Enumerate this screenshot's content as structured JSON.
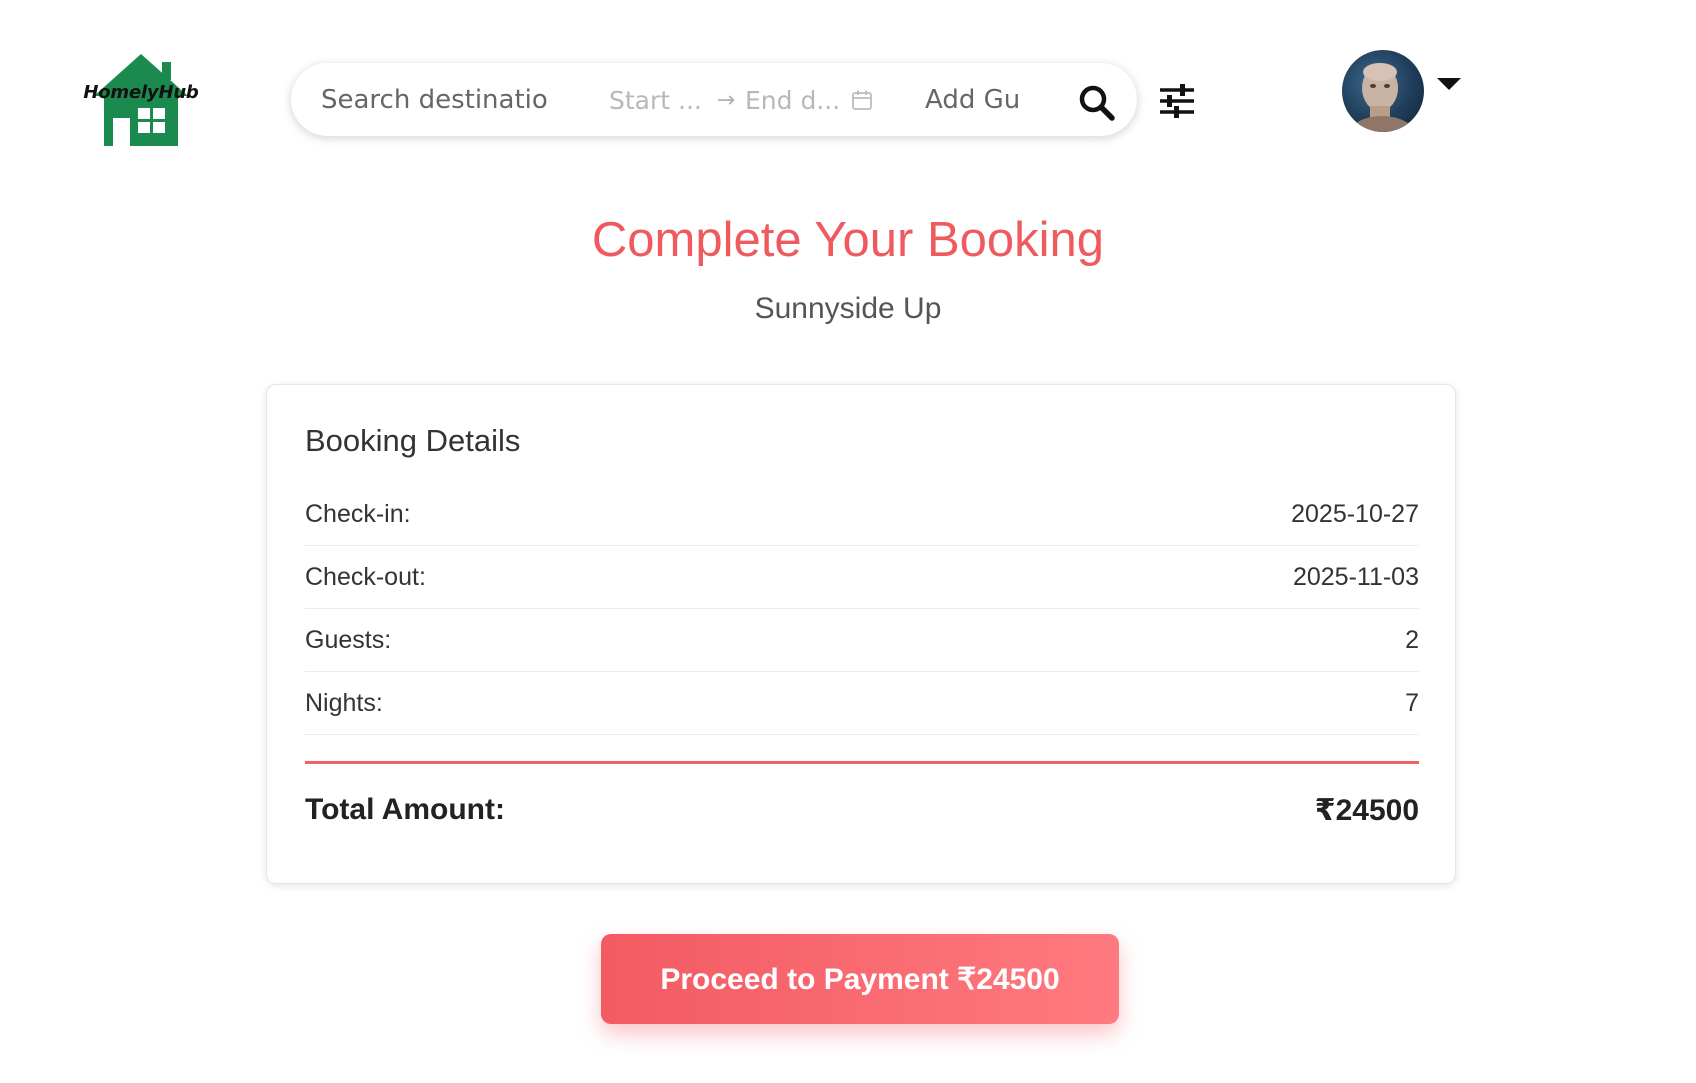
{
  "brand": {
    "name": "HomelyHub",
    "color": "#1b8a4e"
  },
  "search": {
    "destination_placeholder": "Search destinatio",
    "start_date_placeholder": "Start ...",
    "end_date_placeholder": "End d...",
    "guests_placeholder": "Add Gu"
  },
  "icons": {
    "search": "search-icon",
    "filter": "sliders-icon",
    "calendar": "calendar-icon",
    "arrow": "arrow-right-icon",
    "dropdown": "caret-down-icon"
  },
  "page": {
    "title": "Complete Your Booking",
    "property_name": "Sunnyside Up"
  },
  "booking": {
    "section_title": "Booking Details",
    "rows": [
      {
        "label": "Check-in:",
        "value": "2025-10-27"
      },
      {
        "label": "Check-out:",
        "value": "2025-11-03"
      },
      {
        "label": "Guests:",
        "value": "2"
      },
      {
        "label": "Nights:",
        "value": "7"
      }
    ],
    "total_label": "Total Amount:",
    "total_value": "₹24500"
  },
  "actions": {
    "pay_label": "Proceed to Payment ₹24500"
  },
  "colors": {
    "accent": "#ef5a5f",
    "button_start": "#f35a62",
    "button_end": "#ff7a80"
  }
}
